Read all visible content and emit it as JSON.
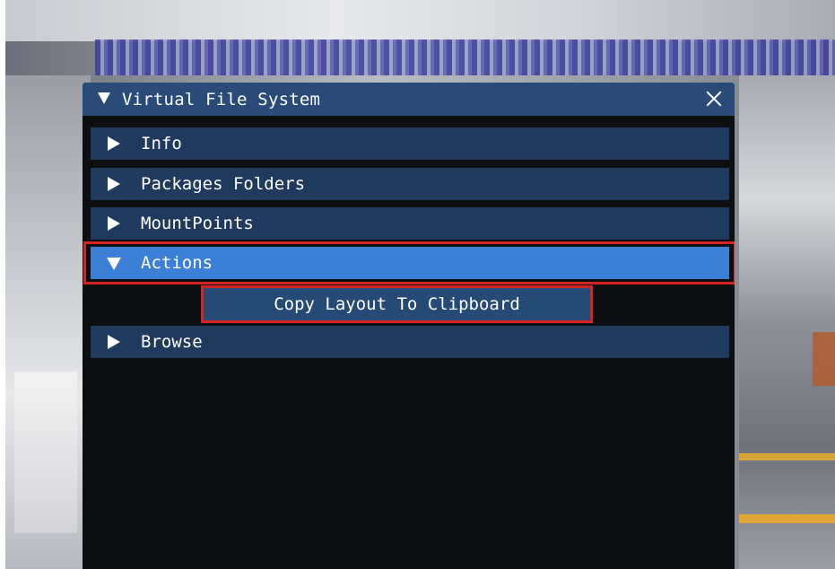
{
  "window": {
    "title": "Virtual File System",
    "close_icon": "close-icon",
    "collapse_icon": "triangle-down-icon"
  },
  "sections": [
    {
      "label": "Info",
      "expanded": false
    },
    {
      "label": "Packages Folders",
      "expanded": false
    },
    {
      "label": "MountPoints",
      "expanded": false
    },
    {
      "label": "Actions",
      "expanded": true
    },
    {
      "label": "Browse",
      "expanded": false
    }
  ],
  "actions": {
    "copy_layout_label": "Copy Layout To Clipboard"
  },
  "colors": {
    "titlebar": "#2a4a78",
    "header": "#203a5e",
    "header_active": "#3b7fd6",
    "button": "#264a76",
    "highlight": "#d42424",
    "window_bg": "#0d0e10"
  }
}
